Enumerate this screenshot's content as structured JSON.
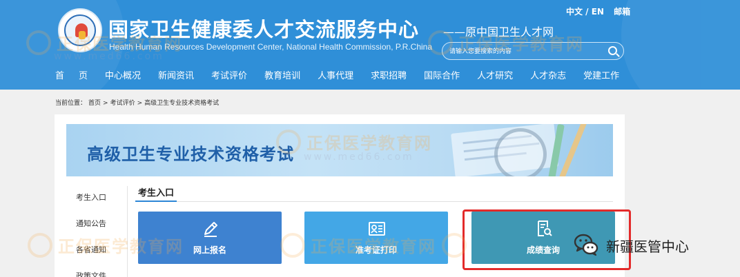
{
  "header": {
    "title": "国家卫生健康委人才交流服务中心",
    "title_en": "Health Human Resources Development Center, National Health Commission, P.R.China",
    "subtitle": "——原中国卫生人才网",
    "lang_link": "中文 / EN",
    "mail_link": "邮箱",
    "search_placeholder": "请输入您要搜索的内容",
    "nav": [
      "首页",
      "中心概况",
      "新闻资讯",
      "考试评价",
      "教育培训",
      "人事代理",
      "求职招聘",
      "国际合作",
      "人才研究",
      "人才杂志",
      "党建工作"
    ]
  },
  "breadcrumb": {
    "prefix": "当前位置：",
    "items": [
      "首页",
      "考试评价",
      "高级卫生专业技术资格考试"
    ],
    "separator": ">"
  },
  "banner": {
    "title": "高级卫生专业技术资格考试"
  },
  "sidebar": {
    "items": [
      "考生入口",
      "通知公告",
      "各省通知",
      "政策文件"
    ]
  },
  "section": {
    "title": "考生入口"
  },
  "cards": [
    {
      "label": "网上报名",
      "icon": "pencil-icon",
      "color": "#3e82d0"
    },
    {
      "label": "准考证打印",
      "icon": "id-card-icon",
      "color": "#43a7e6"
    },
    {
      "label": "成绩查询",
      "icon": "document-search-icon",
      "color": "#3f98b4"
    }
  ],
  "highlight": {
    "color": "#e32a2a",
    "target": "成绩查询"
  },
  "watermark": {
    "text": "正保医学教育网",
    "url": "www.med66.com"
  },
  "wechat_badge": {
    "text": "新疆医管中心",
    "icon": "wechat-icon"
  },
  "colors": {
    "header_bg": "#2f8fd8",
    "banner_title": "#1f5fa8",
    "accent": "#2c86d6"
  }
}
